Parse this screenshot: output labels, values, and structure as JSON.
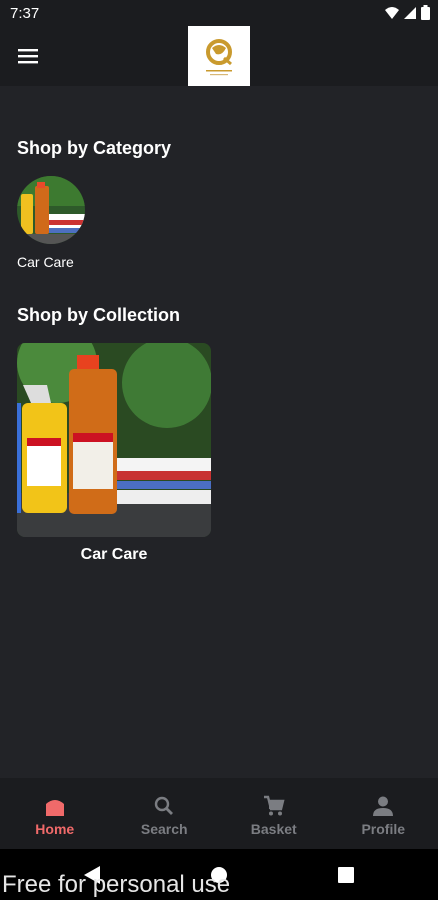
{
  "status_bar": {
    "time": "7:37"
  },
  "header": {
    "menu_icon": "hamburger-menu-icon",
    "logo_icon": "brand-logo"
  },
  "sections": {
    "category_title": "Shop by Category",
    "collection_title": "Shop by Collection"
  },
  "categories": [
    {
      "label": "Car Care"
    }
  ],
  "collections": [
    {
      "label": "Car Care"
    }
  ],
  "bottom_nav": {
    "items": [
      {
        "label": "Home",
        "icon": "home-icon",
        "active": true
      },
      {
        "label": "Search",
        "icon": "search-icon",
        "active": false
      },
      {
        "label": "Basket",
        "icon": "cart-icon",
        "active": false
      },
      {
        "label": "Profile",
        "icon": "person-icon",
        "active": false
      }
    ]
  },
  "colors": {
    "accent": "#f06a6a",
    "background": "#222327",
    "bar": "#1b1c1f",
    "inactive": "#7b7d82"
  },
  "watermark": "Free for personal use"
}
